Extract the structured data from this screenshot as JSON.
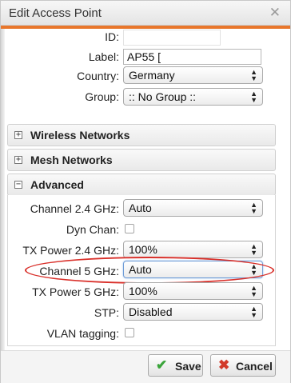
{
  "dialog": {
    "title": "Edit Access Point",
    "close_glyph": "✕"
  },
  "form": {
    "id_label": "ID:",
    "id_value": "",
    "label_label": "Label:",
    "label_value": "AP55 [",
    "country_label": "Country:",
    "country_value": "Germany",
    "group_label": "Group:",
    "group_value": ":: No Group ::"
  },
  "panels": {
    "wireless": {
      "title": "Wireless Networks",
      "toggle": "+"
    },
    "mesh": {
      "title": "Mesh Networks",
      "toggle": "+"
    },
    "advanced": {
      "title": "Advanced",
      "toggle": "−"
    }
  },
  "advanced": {
    "channel24_label": "Channel 2.4 GHz:",
    "channel24_value": "Auto",
    "dynchan_label": "Dyn Chan:",
    "txpower24_label": "TX Power 2.4 GHz:",
    "txpower24_value": "100%",
    "channel5_label": "Channel 5 GHz:",
    "channel5_value": "Auto",
    "txpower5_label": "TX Power 5 GHz:",
    "txpower5_value": "100%",
    "stp_label": "STP:",
    "stp_value": "Disabled",
    "vlan_label": "VLAN tagging:"
  },
  "buttons": {
    "save": "Save",
    "cancel": "Cancel"
  },
  "icons": {
    "updown": "▲▼",
    "save": "✔",
    "cancel": "✖"
  },
  "colors": {
    "accent": "#e8762b",
    "highlight": "#d9302a",
    "save_icon": "#3aa43a",
    "cancel_icon": "#d23a2a"
  }
}
